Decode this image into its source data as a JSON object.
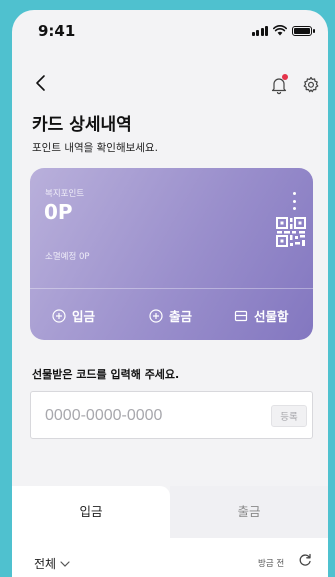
{
  "status_bar": {
    "time": "9:41"
  },
  "header": {
    "title": "카드 상세내역",
    "subtitle": "포인트 내역을 확인해보세요."
  },
  "card": {
    "label": "복지포인트",
    "points": "0P",
    "expiring": "소멸예정 0P",
    "actions": [
      {
        "label": "입금",
        "icon": "plus-circle-icon"
      },
      {
        "label": "출금",
        "icon": "plus-circle-icon"
      },
      {
        "label": "선물함",
        "icon": "gift-box-icon"
      }
    ]
  },
  "gift": {
    "label": "선물받은 코드를 입력해 주세요.",
    "placeholder": "0000-0000-0000",
    "register_label": "등록"
  },
  "tabs": [
    {
      "label": "입금",
      "active": true
    },
    {
      "label": "출금",
      "active": false
    }
  ],
  "filter": {
    "selected": "전체",
    "refresh_label": "방금 전"
  },
  "colors": {
    "background": "#4fc1cf",
    "card_gradient_start": "#b9b0db",
    "card_gradient_end": "#8377c0",
    "notification_dot": "#e5324a"
  }
}
